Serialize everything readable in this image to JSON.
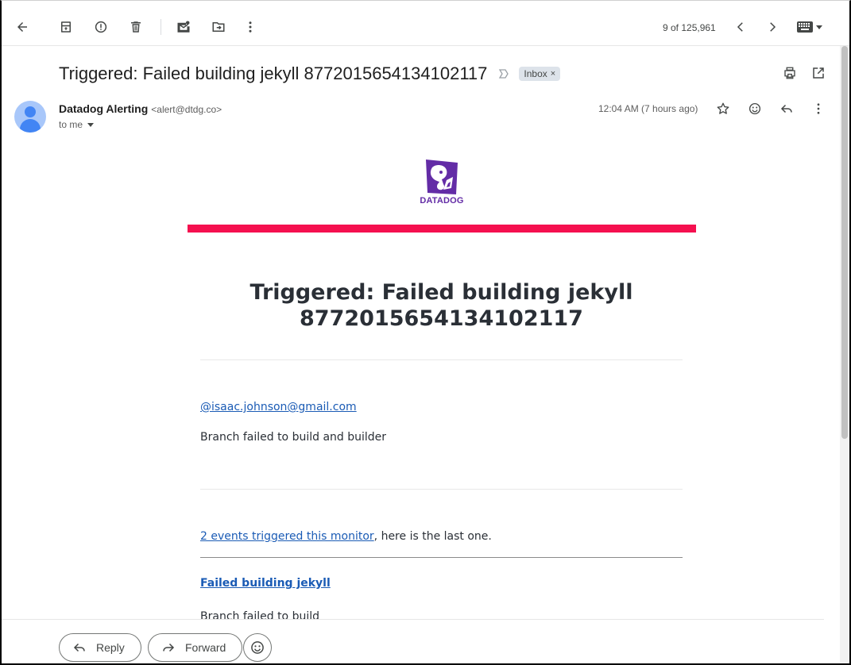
{
  "toolbar": {
    "pager": "9 of 125,961"
  },
  "email": {
    "subject": "Triggered: Failed building jekyll 8772015654134102117",
    "label": "Inbox",
    "label_remove": "×",
    "sender_name": "Datadog Alerting",
    "sender_email": "<alert@dtdg.co>",
    "recipient": "to me",
    "time": "12:04 AM (7 hours ago)"
  },
  "content": {
    "logo_text": "DATADOG",
    "title": "Triggered: Failed building jekyll 8772015654134102117",
    "mention": "@isaac.johnson@gmail.com",
    "message": "Branch failed to build and builder",
    "events_link": "2 events triggered this monitor",
    "events_rest": ", here is the last one.",
    "event_title": "Failed building jekyll",
    "event_body": "Branch failed to build"
  },
  "reply_bar": {
    "reply_label": "Reply",
    "forward_label": "Forward"
  },
  "colors": {
    "alert_bar": "#f5104f",
    "brand_purple": "#632ca6",
    "link": "#1a5bb5"
  },
  "icons": [
    "back-arrow-icon",
    "archive-icon",
    "report-spam-icon",
    "delete-icon",
    "mark-unread-icon",
    "move-to-icon",
    "more-vert-icon",
    "chevron-left-icon",
    "chevron-right-icon",
    "keyboard-icon",
    "importance-icon",
    "print-icon",
    "open-new-window-icon",
    "star-icon",
    "emoji-icon",
    "reply-icon",
    "forward-icon"
  ]
}
